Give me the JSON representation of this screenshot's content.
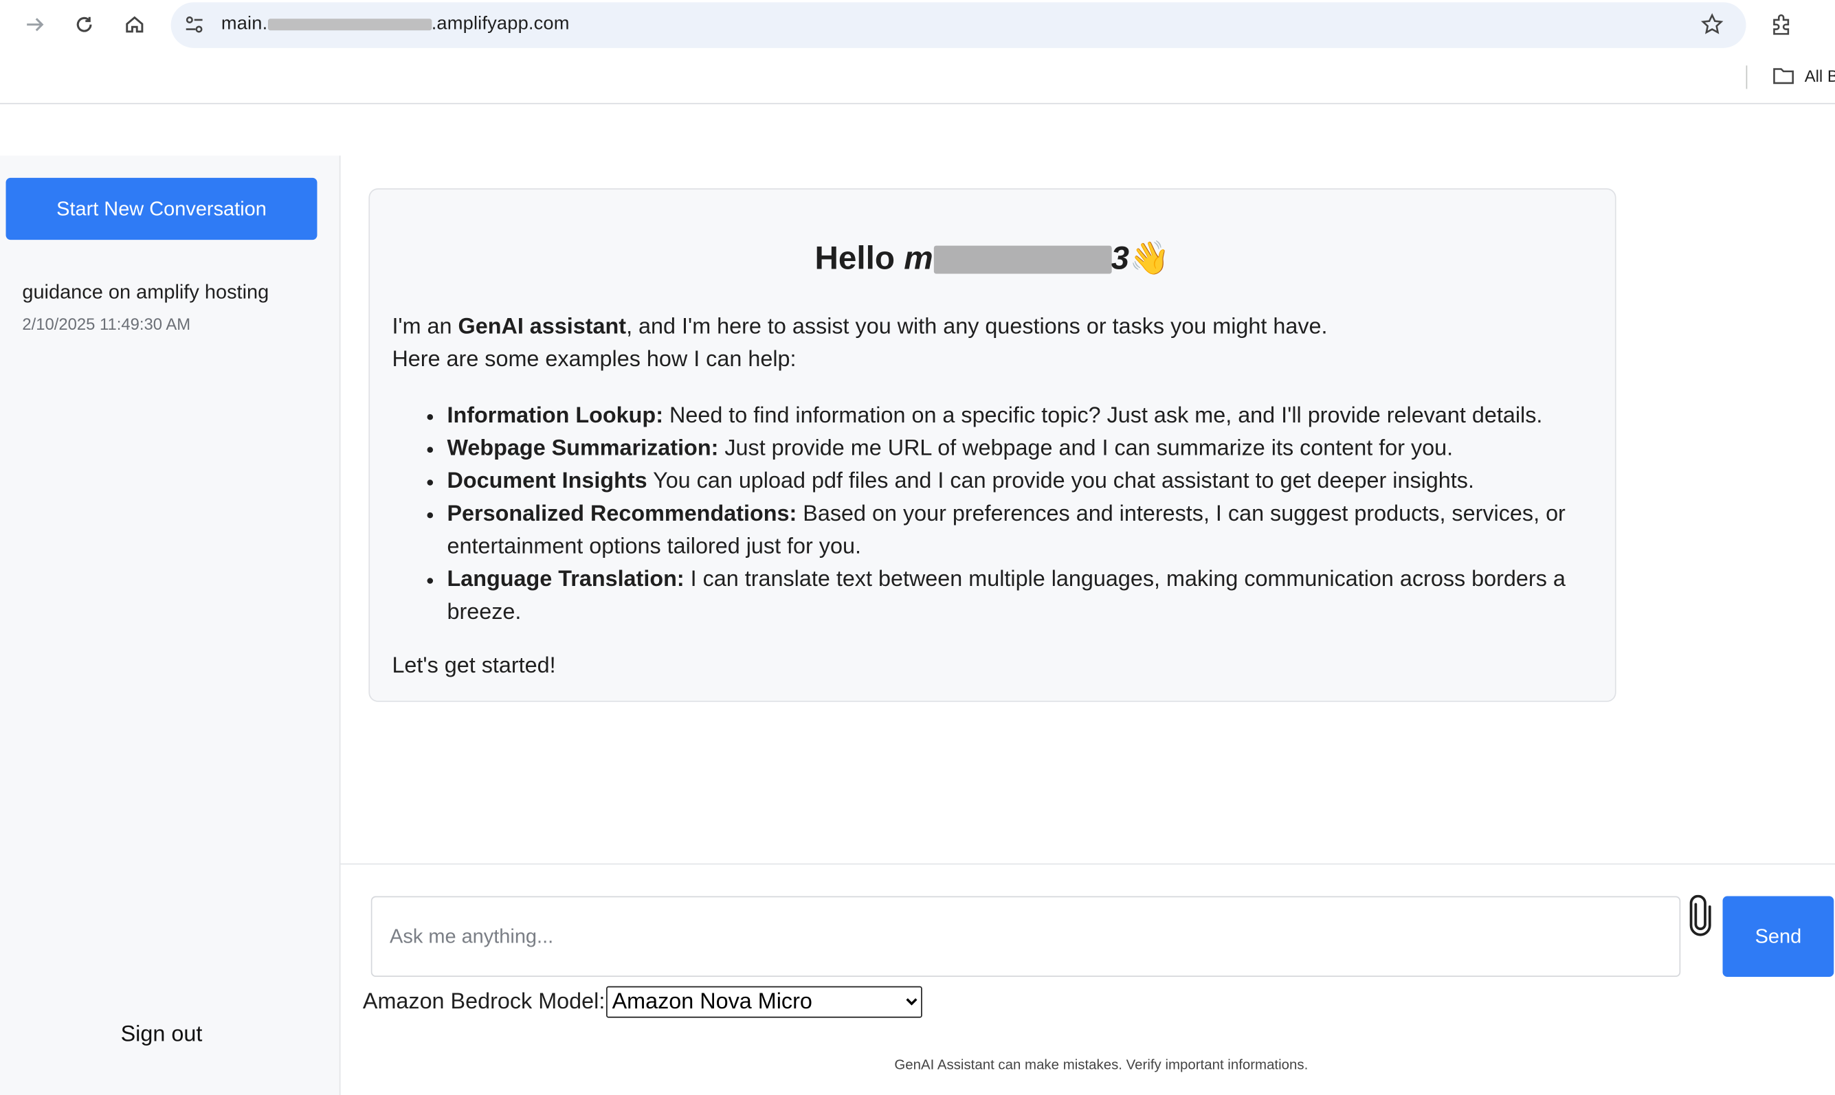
{
  "browser": {
    "url_prefix": "main.",
    "url_suffix": ".amplifyapp.com",
    "bookmarks_label": "All B"
  },
  "sidebar": {
    "new_conversation_label": "Start New Conversation",
    "conversations": [
      {
        "title": "guidance on amplify hosting",
        "timestamp": "2/10/2025 11:49:30 AM"
      }
    ],
    "sign_out_label": "Sign out"
  },
  "welcome": {
    "hello_prefix": "Hello",
    "username_visible_start": "m",
    "username_visible_end": "3",
    "wave_emoji": "👋",
    "intro_pre": "I'm an ",
    "intro_bold": "GenAI assistant",
    "intro_post": ", and I'm here to assist you with any questions or tasks you might have.",
    "intro_line2": "Here are some examples how I can help:",
    "examples": [
      {
        "title": "Information Lookup:",
        "text": " Need to find information on a specific topic? Just ask me, and I'll provide relevant details."
      },
      {
        "title": "Webpage Summarization:",
        "text": " Just provide me URL of webpage and I can summarize its content for you."
      },
      {
        "title": "Document Insights",
        "text": " You can upload pdf files and I can provide you chat assistant to get deeper insights."
      },
      {
        "title": "Personalized Recommendations:",
        "text": " Based on your preferences and interests, I can suggest products, services, or entertainment options tailored just for you."
      },
      {
        "title": "Language Translation:",
        "text": " I can translate text between multiple languages, making communication across borders a breeze."
      }
    ],
    "closing": "Let's get started!"
  },
  "composer": {
    "placeholder": "Ask me anything...",
    "value": "",
    "send_label": "Send",
    "model_label": "Amazon Bedrock Model:",
    "model_selected": "Amazon Nova Micro"
  },
  "footer": {
    "disclaimer": "GenAI Assistant can make mistakes. Verify important informations."
  },
  "colors": {
    "primary_button": "#2f7bf5",
    "sidebar_bg": "#f7f8fa",
    "card_bg": "#f7f8fa"
  }
}
